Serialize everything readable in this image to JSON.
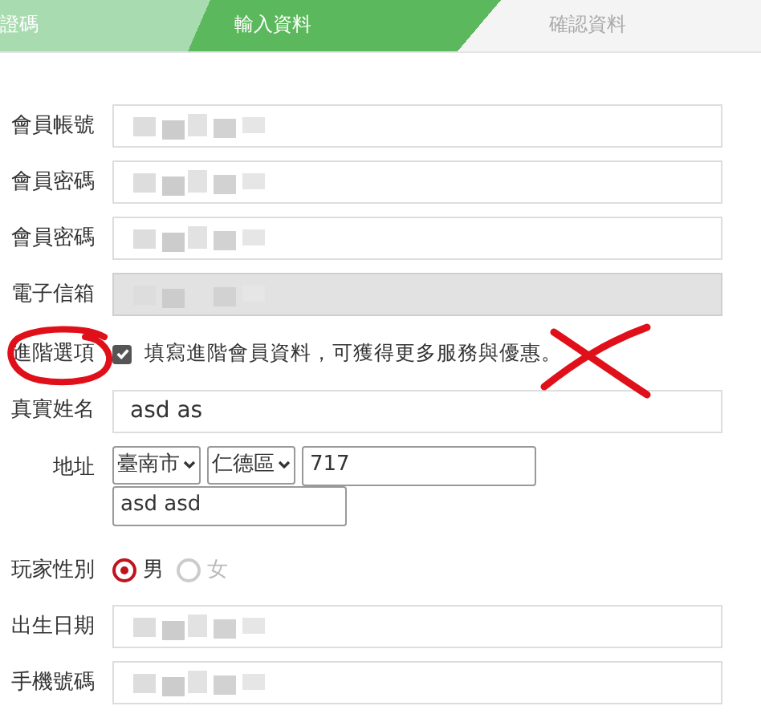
{
  "steps": [
    {
      "label": "證碼",
      "selected": false,
      "done": true
    },
    {
      "label": "輸入資料",
      "selected": true,
      "done": false
    },
    {
      "label": "確認資料",
      "selected": false,
      "done": false
    }
  ],
  "fields": [
    {
      "label": "會員帳號",
      "kind": "blurred",
      "disabled": false
    },
    {
      "label": "會員密碼",
      "kind": "blurred",
      "disabled": false
    },
    {
      "label": "會員密碼",
      "kind": "blurred",
      "disabled": false
    },
    {
      "label": "電子信箱",
      "kind": "blurred",
      "disabled": true
    }
  ],
  "advanced": {
    "label": "進階選項",
    "checked": true,
    "text": "填寫進階會員資料，可獲得更多服務與優惠。"
  },
  "real_name": {
    "label": "真實姓名",
    "value": "asd as"
  },
  "address": {
    "label": "地址",
    "city": "臺南市",
    "district": "仁德區",
    "zip": "717",
    "street": "asd asd"
  },
  "gender": {
    "label": "玩家性別",
    "options": [
      {
        "label": "男",
        "selected": true
      },
      {
        "label": "女",
        "selected": false
      }
    ]
  },
  "extra_fields": [
    {
      "label": "出生日期",
      "kind": "blurred",
      "disabled": false
    },
    {
      "label": "手機號碼",
      "kind": "blurred",
      "disabled": false
    }
  ],
  "annotations": [
    {
      "kind": "circle"
    },
    {
      "kind": "cross"
    }
  ]
}
